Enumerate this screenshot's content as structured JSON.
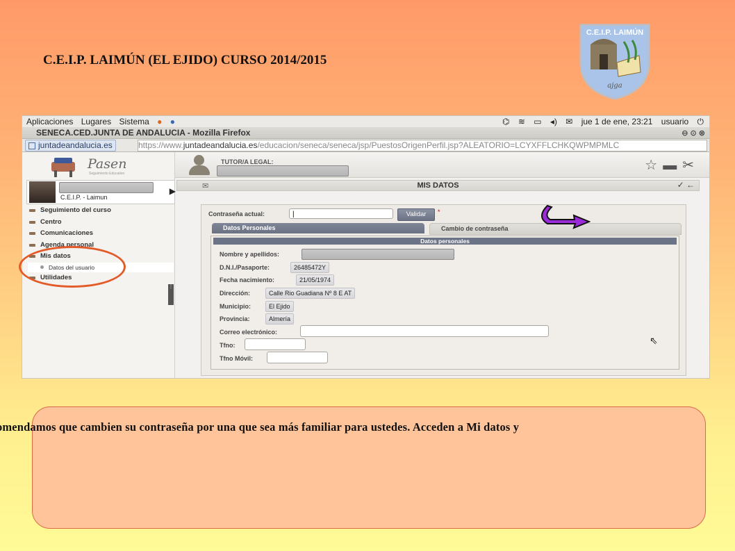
{
  "slide": {
    "title": "C.E.I.P. LAIMÚN (EL EJIDO)  CURSO 2014/2015",
    "logo_text": "C.E.I.P. LAIMÚN",
    "note": "omendamos que cambien su contraseña por una que sea más familiar para ustedes. Acceden a Mi datos y"
  },
  "desktop_panel": {
    "menus": [
      "Aplicaciones",
      "Lugares",
      "Sistema"
    ],
    "clock": "jue 1 de ene, 23:21",
    "user": "usuario"
  },
  "browser": {
    "window_title": "SENECA.CED.JUNTA DE ANDALUCIA - Mozilla Firefox",
    "site_identity": "juntadeandalucia.es",
    "url_prefix": "https://www.",
    "url_host": "juntadeandalucia.es",
    "url_path": "/educacion/seneca/seneca/jsp/PuestosOrigenPerfil.jsp?ALEATORIO=LCYXFFLCHKQWPMPMLC"
  },
  "app": {
    "logo": "Pasen",
    "logo_sub": "Seguimiento Educativo",
    "user_school": "C.E.I.P. - Laimun",
    "tutor_label": "TUTOR/A LEGAL:",
    "page_title": "MIS DATOS",
    "menu": [
      "Seguimiento del curso",
      "Centro",
      "Comunicaciones",
      "Agenda personal",
      "Mis datos"
    ],
    "submenu_selected": "Datos del usuario",
    "menu_last": "Utilidades"
  },
  "form": {
    "current_password_label": "Contraseña actual:",
    "current_password_value": "|",
    "validate_button": "Validar",
    "required_mark": "*",
    "tabs": [
      "Datos Personales",
      "Cambio de contraseña"
    ],
    "section_title": "Datos personales",
    "fields": {
      "name_label": "Nombre y apellidos:",
      "dni_label": "D.N.I./Pasaporte:",
      "dni_value": "26485472Y",
      "birth_label": "Fecha nacimiento:",
      "birth_value": "21/05/1974",
      "address_label": "Dirección:",
      "address_value": "Calle Rio Guadiana Nº 8 E AT",
      "city_label": "Municipio:",
      "city_value": "El Ejido",
      "province_label": "Provincia:",
      "province_value": "Almería",
      "email_label": "Correo electrónico:",
      "phone_label": "Tfno:",
      "mobile_label": "Tfno Móvil:"
    }
  },
  "colors": {
    "bg_top": "#ff9a68",
    "bg_bottom": "#fffb96",
    "annotation_circle": "#e45b2a",
    "annotation_arrow": "#9a2bd9",
    "note_box": "#ffc49a"
  }
}
